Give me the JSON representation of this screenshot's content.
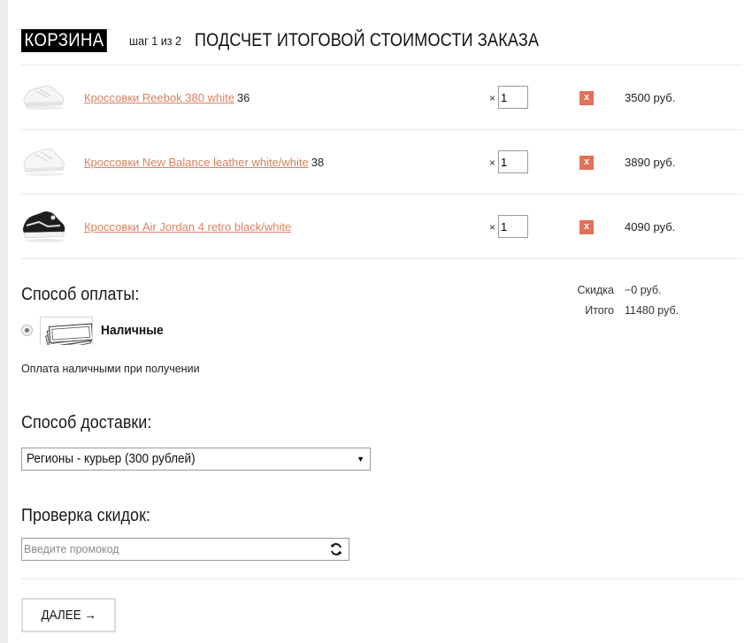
{
  "header": {
    "cart_label": "КОРЗИНА",
    "step_text": "шаг 1 из 2",
    "title": "ПОДСЧЕТ ИТОГОВОЙ СТОИМОСТИ ЗАКАЗА"
  },
  "cart": {
    "items": [
      {
        "name": "Кроссовки Reebok 380 white",
        "size": "36",
        "qty_prefix": "×",
        "qty": "1",
        "remove_label": "x",
        "price": "3500 руб.",
        "image": "white-sneaker"
      },
      {
        "name": "Кроссовки New Balance leather white/white",
        "size": "38",
        "qty_prefix": "×",
        "qty": "1",
        "remove_label": "x",
        "price": "3890 руб.",
        "image": "white-sneaker"
      },
      {
        "name": "Кроссовки Air Jordan 4 retro black/white",
        "size": "",
        "qty_prefix": "×",
        "qty": "1",
        "remove_label": "x",
        "price": "4090 руб.",
        "image": "black-sneaker"
      }
    ]
  },
  "totals": {
    "discount_label": "Скидка",
    "discount_value": "−0 руб.",
    "total_label": "Итого",
    "total_value": "11480 руб."
  },
  "payment": {
    "title": "Способ оплаты:",
    "option_label": "Наличные",
    "selected": true,
    "description": "Оплата наличными при получении",
    "icon": "cash-icon"
  },
  "delivery": {
    "title": "Способ доставки:",
    "selected_option": "Регионы - курьер (300 рублей)"
  },
  "promo": {
    "title": "Проверка скидок:",
    "placeholder": "Введите промокод",
    "value": ""
  },
  "actions": {
    "next_label": "ДАЛЕЕ →"
  }
}
